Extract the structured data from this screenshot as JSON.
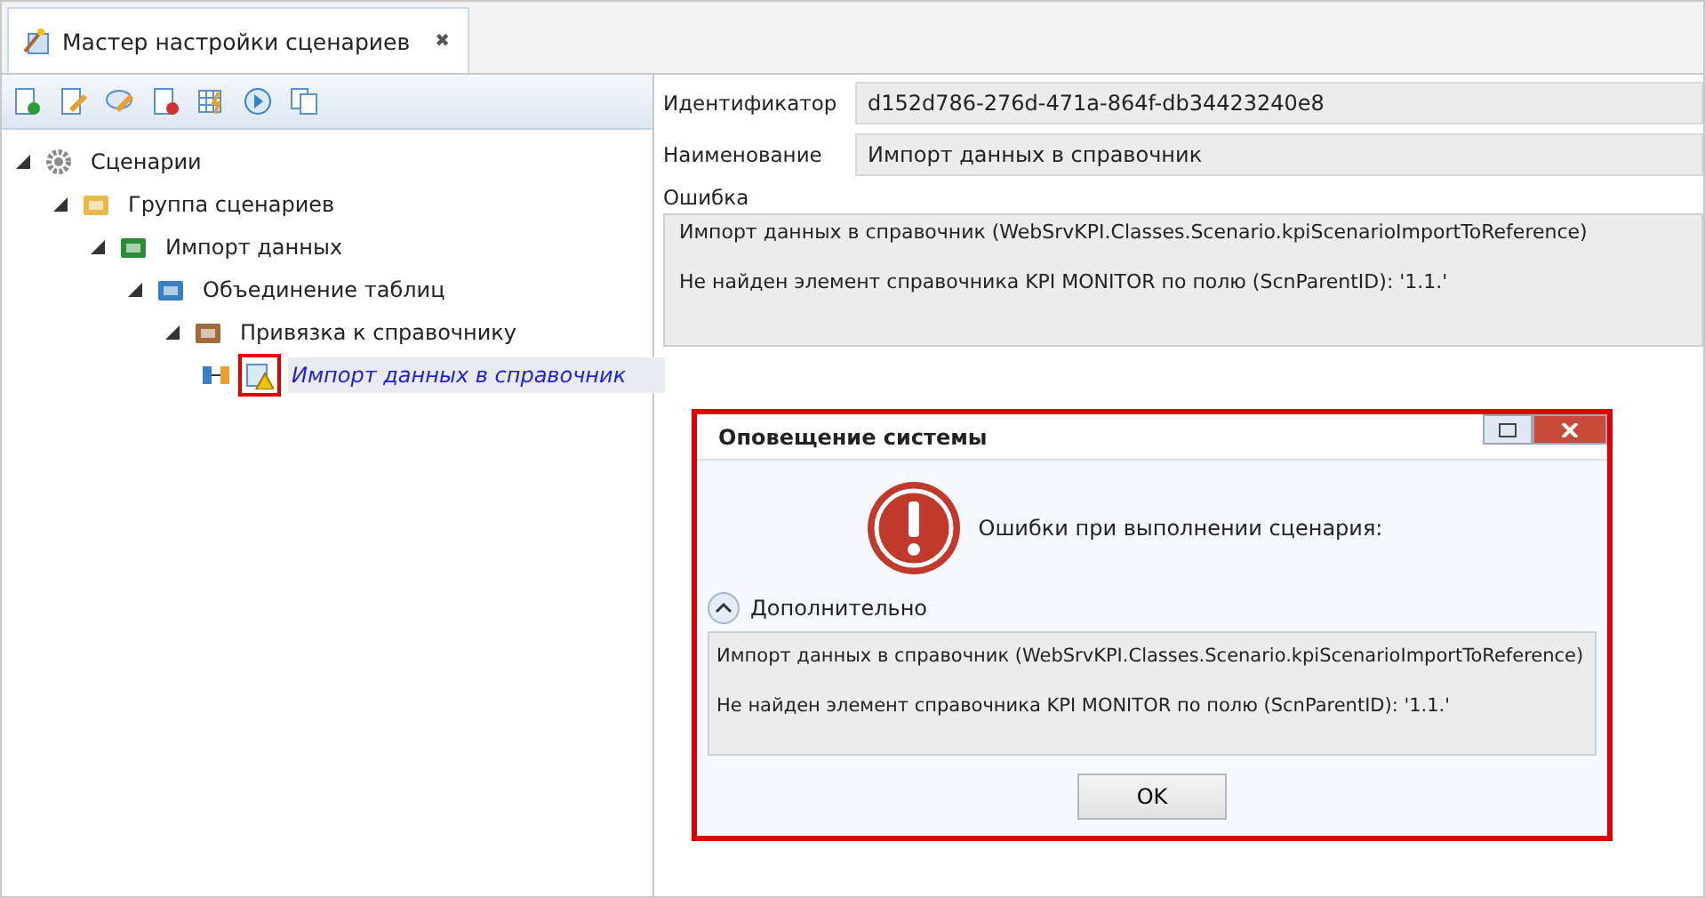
{
  "tab": {
    "title": "Мастер настройки сценариев",
    "close": "✖"
  },
  "tree": [
    {
      "label": "Сценарии",
      "kind": "gear",
      "expanded": true,
      "selected": false,
      "children": [
        {
          "label": "Группа сценариев",
          "kind": "folder",
          "expanded": true,
          "selected": false,
          "children": [
            {
              "label": "Импорт данных",
              "kind": "spreadsheet",
              "expanded": true,
              "selected": false,
              "children": [
                {
                  "label": "Объединение таблиц",
                  "kind": "merge",
                  "expanded": true,
                  "selected": false,
                  "children": [
                    {
                      "label": "Привязка к справочнику",
                      "kind": "reference",
                      "expanded": true,
                      "selected": false,
                      "children": [
                        {
                          "label": "Импорт данных в справочник",
                          "kind": "warning",
                          "selected": true,
                          "highlighted": true
                        }
                      ]
                    }
                  ]
                }
              ]
            }
          ]
        }
      ]
    }
  ],
  "fields": [
    {
      "label": "Идентификатор",
      "value": "d152d786-276d-471a-864f-db34423240e8"
    },
    {
      "label": "Наименование",
      "value": "Импорт данных в справочник"
    }
  ],
  "error": {
    "label": "Ошибка",
    "lines": [
      "Импорт данных в справочник  (WebSrvKPI.Classes.Scenario.kpiScenarioImportToReference)",
      "Не найден элемент справочника KPI MONITOR по полю (ScnParentID): '1.1.'"
    ]
  },
  "dialog": {
    "title": "Оповещение системы",
    "highlighted": true,
    "message": "Ошибки при выполнении сценария:",
    "details_label": "Дополнительно",
    "details_expanded": true,
    "details": [
      "Импорт данных в справочник  (WebSrvKPI.Classes.Scenario.kpiScenarioImportToReference)",
      "Не найден элемент справочника KPI MONITOR по полю (ScnParentID): '1.1.'"
    ],
    "button": "OK"
  }
}
